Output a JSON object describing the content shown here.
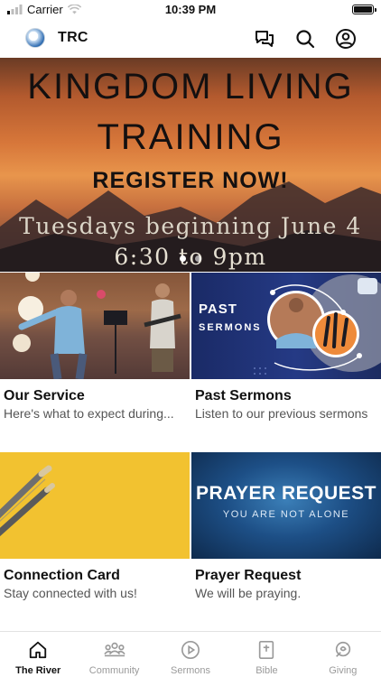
{
  "status_bar": {
    "carrier": "Carrier",
    "time": "10:39 PM"
  },
  "header": {
    "title": "TRC"
  },
  "banner": {
    "line1": "KINGDOM LIVING",
    "line2": "TRAINING",
    "line3": "REGISTER NOW!",
    "line4": "Tuesdays beginning June 4",
    "line5": "6:30 to 9pm",
    "slide_count": 2,
    "active_slide": 1
  },
  "cards": [
    {
      "title": "Our Service",
      "subtitle": "Here's what to expect during..."
    },
    {
      "title": "Past Sermons",
      "subtitle": "Listen to our previous sermons",
      "image_text": {
        "line1": "PAST",
        "line2": "SERMONS"
      }
    },
    {
      "title": "Connection Card",
      "subtitle": "Stay connected with us!"
    },
    {
      "title": "Prayer Request",
      "subtitle": "We will be praying.",
      "image_text": {
        "line1": "PRAYER REQUEST",
        "line2": "YOU ARE NOT ALONE"
      }
    }
  ],
  "tabs": [
    {
      "label": "The River",
      "icon": "home-icon",
      "active": true
    },
    {
      "label": "Community",
      "icon": "community-icon",
      "active": false
    },
    {
      "label": "Sermons",
      "icon": "play-circle-icon",
      "active": false
    },
    {
      "label": "Bible",
      "icon": "bible-icon",
      "active": false
    },
    {
      "label": "Giving",
      "icon": "giving-icon",
      "active": false
    }
  ],
  "colors": {
    "accent": "#111111",
    "inactive_tab": "#9a9a9a",
    "connection_card_bg": "#f2c230",
    "sermons_bg": "#1f2f6d"
  }
}
